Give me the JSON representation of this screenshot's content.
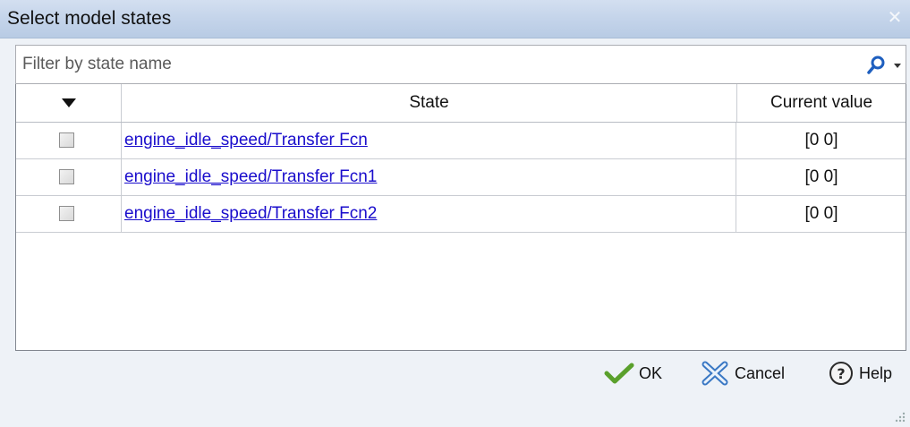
{
  "window": {
    "title": "Select model states",
    "close_glyph": "✕"
  },
  "filter": {
    "placeholder": "Filter by state name",
    "value": "",
    "icons": [
      "search-icon",
      "dropdown-arrow-icon"
    ]
  },
  "table": {
    "columns": [
      {
        "label": "",
        "icon": "sort-down-triangle-icon"
      },
      {
        "label": "State"
      },
      {
        "label": "Current value"
      }
    ],
    "rows": [
      {
        "checked": false,
        "state": "engine_idle_speed/Transfer Fcn",
        "value": "[0 0]"
      },
      {
        "checked": false,
        "state": "engine_idle_speed/Transfer Fcn1",
        "value": "[0 0]"
      },
      {
        "checked": false,
        "state": "engine_idle_speed/Transfer Fcn2",
        "value": "[0 0]"
      }
    ]
  },
  "buttons": {
    "ok": {
      "label": "OK",
      "icon": "checkmark-icon"
    },
    "cancel": {
      "label": "Cancel",
      "icon": "cancel-x-icon"
    },
    "help": {
      "label": "Help",
      "icon": "help-question-icon"
    }
  },
  "colors": {
    "link": "#1a0dcc",
    "titlebar": "#c4d4ea",
    "ok_check": "#5aa02c",
    "cancel_x": "#3a78c4",
    "help_circle": "#2a2a2a"
  }
}
